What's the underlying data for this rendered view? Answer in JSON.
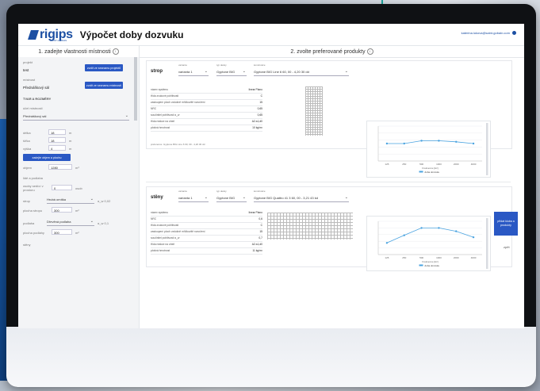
{
  "app": {
    "brand": "rigips",
    "brand_sub": "SAINT-GOBAIN",
    "title": "Výpočet doby dozvuku",
    "user": "katerina.lukova@saint-gobain.com"
  },
  "steps": {
    "step1": "1. zadejte vlastnosti místnosti",
    "step2": "2. zvolte preferované produkty"
  },
  "left": {
    "project_label": "projekt",
    "project_value": "test",
    "room_label": "místnost",
    "room_value": "Přednáškový sál",
    "load_project_btn": "zvolit ze seznamu projektů",
    "load_room_btn": "zvolit ze seznamu místností",
    "section_label": "TVAR A ROZMĚRY",
    "purpose_label": "účel místnosti",
    "purpose_value": "Přednáškový sál",
    "length_label": "délka",
    "length_value": "18",
    "width_label": "šířka",
    "width_value": "18",
    "height_label": "výška",
    "height_value": "4",
    "unit_m": "m",
    "area_btn": "zadejte objem a plochu",
    "volume_label": "objem",
    "volume_value": "1280",
    "unit_m3": "m³",
    "people_label": "lidé a podlaha",
    "people_count_label": "osoby sedící v prostoru",
    "people_value": "0",
    "people_unit": "osob",
    "ceiling_label": "strop",
    "ceiling_select": "Hrubá omítka",
    "ceiling_alpha": "α_w 0,02",
    "ceiling_area_label": "plocha stropu",
    "ceiling_area_value": "300",
    "floor_label": "podlaha",
    "floor_select": "Dřevěná podlaha",
    "floor_alpha": "α_w 0,1",
    "floor_area_label": "plocha podlahy",
    "floor_area_value": "300",
    "unit_m2": "m²",
    "walls_label": "stěny"
  },
  "ceiling_card": {
    "title": "strop",
    "variant_label": "varianta",
    "variant_value": "varianta 1",
    "type_label": "typ desky",
    "type_value": "Gyptone BIG",
    "construction_label": "konstrukce",
    "construction_value": "Gyptone BIG Line 6 60, 00 - 4,20 30 dd",
    "rows": [
      {
        "label": "název systému",
        "value": "linear Plano"
      },
      {
        "label": "třída zvukové pohltivosti",
        "value": "C"
      },
      {
        "label": "zastoupení ploch vzdušně mřížkovitě rozvržení",
        "value": "15"
      },
      {
        "label": "NRC",
        "value": "0,65"
      },
      {
        "label": "součinitel pohltivosti α_w",
        "value": "0,65"
      },
      {
        "label": "třída reakce na oheň",
        "value": "A2-s1,d0"
      },
      {
        "label": "plošná hmotnost",
        "value": "10 kg/m²"
      }
    ],
    "preference_note": "preference: Gyptone BIG Line 6 60, 00 - 4,20 30 dd"
  },
  "walls_card": {
    "title": "stěny",
    "variant_label": "varianta",
    "variant_value": "varianta 1",
    "type_label": "typ desky",
    "type_value": "Gyptone BIG",
    "construction_label": "konstrukce",
    "construction_value": "Gyptone BIG Quattro 41 3 60, 00 - 3,21 43 kd",
    "rows": [
      {
        "label": "název systému",
        "value": "linear Plano"
      },
      {
        "label": "NRC",
        "value": "0,6"
      },
      {
        "label": "třída zvukové pohltivosti",
        "value": "C"
      },
      {
        "label": "zastoupení ploch vzdušně mřížkovitě rozvržení",
        "value": "15"
      },
      {
        "label": "součinitel pohltivosti α_w",
        "value": "0,7"
      },
      {
        "label": "třída reakce na oheň",
        "value": "A2-s1,d0"
      },
      {
        "label": "plošná hmotnost",
        "value": "11 kg/m²"
      }
    ]
  },
  "side_button": "přidat kluba a produkty",
  "side_link": "zpět",
  "charts": [
    {
      "type": "line",
      "x_categories": [
        "125",
        "250",
        "500",
        "1000",
        "2000",
        "4000"
      ],
      "values": [
        0.5,
        0.5,
        0.58,
        0.58,
        0.55,
        0.5
      ],
      "ylim": [
        0,
        1
      ],
      "xlabel": "Frekvence [Hz]",
      "legend": "doba dozvuku",
      "color": "#4aa3e0"
    },
    {
      "type": "line",
      "x_categories": [
        "125",
        "250",
        "500",
        "1000",
        "2000",
        "4000"
      ],
      "values": [
        0.35,
        0.58,
        0.8,
        0.8,
        0.7,
        0.52
      ],
      "ylim": [
        0,
        1
      ],
      "xlabel": "Frekvence [Hz]",
      "legend": "doba dozvuku",
      "color": "#4aa3e0"
    }
  ]
}
